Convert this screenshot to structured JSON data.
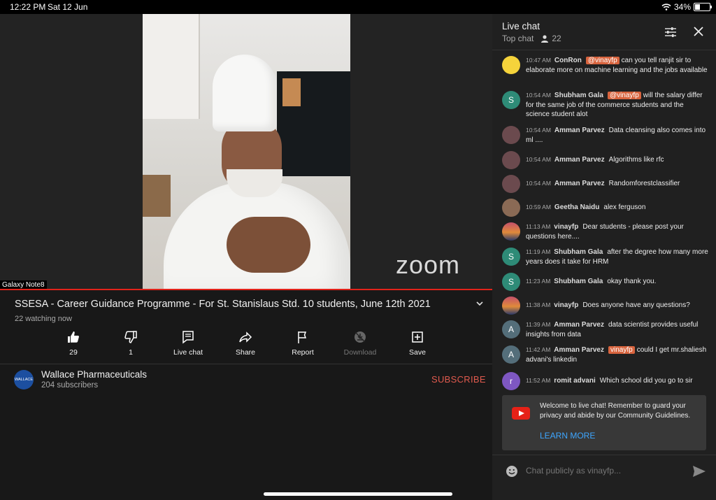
{
  "status_bar": {
    "time": "12:22 PM",
    "date": "Sat 12 Jun",
    "battery": "34%",
    "battery_level": 0.34
  },
  "video": {
    "overlay_logo": "zoom",
    "camera_label": "Galaxy Note8",
    "title": "SSESA - Career Guidance Programme - For St. Stanislaus Std. 10 students, June 12th 2021",
    "watching": "22 watching now"
  },
  "actions": [
    {
      "icon": "thumbs-up-icon",
      "label": "29"
    },
    {
      "icon": "thumbs-down-icon",
      "label": "1"
    },
    {
      "icon": "live-chat-icon",
      "label": "Live chat"
    },
    {
      "icon": "share-icon",
      "label": "Share"
    },
    {
      "icon": "flag-icon",
      "label": "Report"
    },
    {
      "icon": "download-icon",
      "label": "Download",
      "disabled": true
    },
    {
      "icon": "save-icon",
      "label": "Save"
    }
  ],
  "channel": {
    "name": "Wallace Pharmaceuticals",
    "subscribers": "204 subscribers",
    "avatar_text": "WALLACE",
    "subscribe_label": "SUBSCRIBE"
  },
  "chat": {
    "title": "Live chat",
    "mode": "Top chat",
    "viewers": "22",
    "messages": [
      {
        "time": "10:47 AM",
        "author": "ConRon",
        "mention": "@vinayfp",
        "text": "can you tell ranjit sir to elaborate more on machine learning and the jobs available",
        "avatar": "",
        "avatar_color": "#f5d33b"
      },
      {
        "time": "10:54 AM",
        "author": "Shubham Gala",
        "mention": "@vinayfp",
        "text": "will the salary differ for the same job of the commerce students and the science student alot",
        "avatar": "S",
        "avatar_color": "#2e8b77"
      },
      {
        "time": "10:54 AM",
        "author": "Amman Parvez",
        "mention": "",
        "text": "Data cleansing also comes into ml ....",
        "avatar": "",
        "avatar_color": "#6b4a4e"
      },
      {
        "time": "10:54 AM",
        "author": "Amman Parvez",
        "mention": "",
        "text": "Algorithms like rfc",
        "avatar": "",
        "avatar_color": "#6b4a4e"
      },
      {
        "time": "10:54 AM",
        "author": "Amman Parvez",
        "mention": "",
        "text": "Randomforestclassifier",
        "avatar": "",
        "avatar_color": "#6b4a4e"
      },
      {
        "time": "10:59 AM",
        "author": "Geetha Naidu",
        "mention": "",
        "text": "alex ferguson",
        "avatar": "",
        "avatar_color": "#8a6a55"
      },
      {
        "time": "11:13 AM",
        "author": "vinayfp",
        "mention": "",
        "text": "Dear students - please post your questions here....",
        "avatar": "",
        "avatar_color": "#7a4a70"
      },
      {
        "time": "11:19 AM",
        "author": "Shubham Gala",
        "mention": "",
        "text": "after the degree how many more years does it take for HRM",
        "avatar": "S",
        "avatar_color": "#2e8b77"
      },
      {
        "time": "11:23 AM",
        "author": "Shubham Gala",
        "mention": "",
        "text": "okay thank you.",
        "avatar": "S",
        "avatar_color": "#2e8b77"
      },
      {
        "time": "11:38 AM",
        "author": "vinayfp",
        "mention": "",
        "text": "Does anyone have any questions?",
        "avatar": "",
        "avatar_color": "#7a4a70"
      },
      {
        "time": "11:39 AM",
        "author": "Amman Parvez",
        "mention": "",
        "text": "data scientist provides useful insights from data",
        "avatar": "A",
        "avatar_color": "#546e7a"
      },
      {
        "time": "11:42 AM",
        "author": "Amman Parvez",
        "mention": "vinayfp",
        "text": "could I get mr.shaliesh advani's linkedin",
        "avatar": "A",
        "avatar_color": "#546e7a"
      },
      {
        "time": "11:52 AM",
        "author": "romit advani",
        "mention": "",
        "text": "Which school did you go to sir",
        "avatar": "r",
        "avatar_color": "#7e57c2"
      }
    ],
    "welcome": "Welcome to live chat! Remember to guard your privacy and abide by our Community Guidelines.",
    "learn_more": "LEARN MORE",
    "input_placeholder": "Chat publicly as vinayfp..."
  }
}
